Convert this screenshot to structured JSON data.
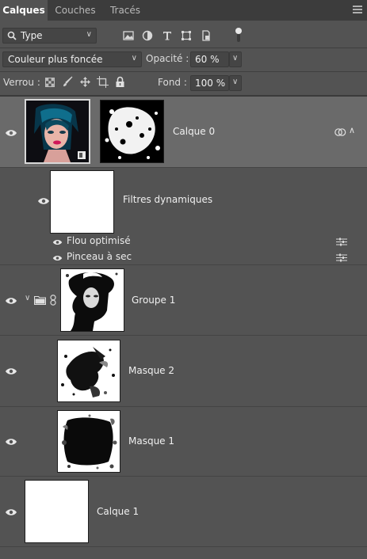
{
  "tabs": [
    {
      "label": "Calques"
    },
    {
      "label": "Couches"
    },
    {
      "label": "Tracés"
    }
  ],
  "filter": {
    "selected": "Type"
  },
  "blend": {
    "mode": "Couleur plus foncée",
    "opacity_label": "Opacité :",
    "opacity_value": "60 %"
  },
  "lock": {
    "label": "Verrou :",
    "fill_label": "Fond :",
    "fill_value": "100 %"
  },
  "layers": [
    {
      "name": "Calque 0"
    },
    {
      "name": "Filtres dynamiques"
    },
    {
      "name": "Flou optimisé"
    },
    {
      "name": "Pinceau à sec"
    },
    {
      "name": "Groupe 1"
    },
    {
      "name": "Masque 2"
    },
    {
      "name": "Masque 1"
    },
    {
      "name": "Calque 1"
    }
  ],
  "icons": {
    "menu": "panel-menu-icon",
    "search": "search-icon",
    "pixel_filter": "image-filter-icon",
    "adjustment_filter": "adjustment-filter-icon",
    "type_filter": "type-filter-icon",
    "shape_filter": "shape-filter-icon",
    "smart_filter": "smart-object-filter-icon",
    "toggle": "filter-toggle-icon",
    "lock_pixels": "lock-transparent-pixels-icon",
    "lock_paint": "lock-image-pixels-icon",
    "lock_position": "lock-position-icon",
    "lock_artboard": "lock-artboard-icon",
    "lock_all": "lock-all-icon",
    "eye": "eye-icon",
    "folder": "folder-icon",
    "chain": "link-chain-icon",
    "filter_options": "filter-options-icon"
  },
  "colors": {
    "panel_bg": "#535353",
    "tabbar_bg": "#3c3c3c",
    "selected_row": "#6a6a6a"
  }
}
